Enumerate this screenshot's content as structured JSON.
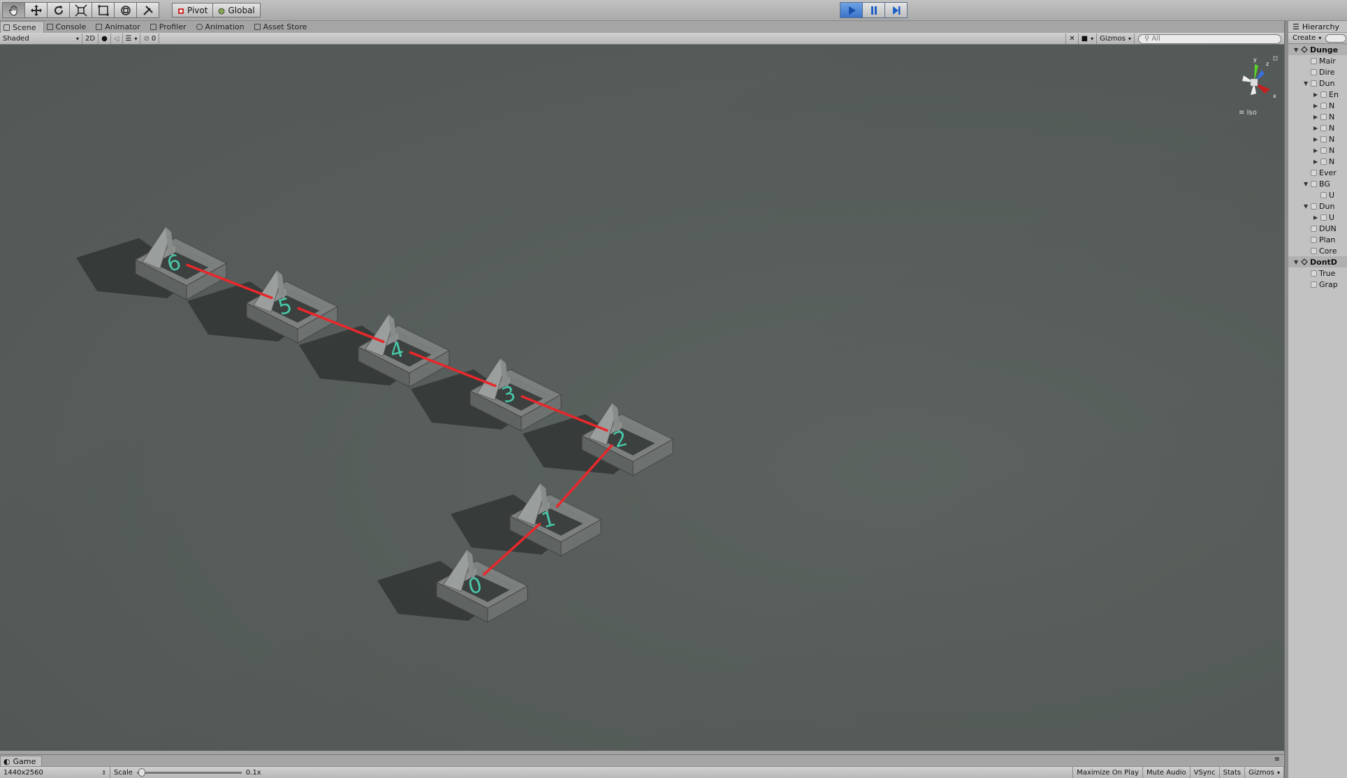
{
  "toolbar": {
    "tools": [
      "hand-icon",
      "move-icon",
      "rotate-icon",
      "scale-icon",
      "rect-icon",
      "transform-icon",
      "custom-tool-icon"
    ],
    "pivot_label": "Pivot",
    "global_label": "Global",
    "play_buttons": [
      "play-icon",
      "pause-icon",
      "step-icon"
    ]
  },
  "tabs": [
    {
      "label": "Scene",
      "icon": "scene-icon"
    },
    {
      "label": "Console",
      "icon": "console-icon"
    },
    {
      "label": "Animator",
      "icon": "animator-icon"
    },
    {
      "label": "Profiler",
      "icon": "profiler-icon"
    },
    {
      "label": "Animation",
      "icon": "animation-icon"
    },
    {
      "label": "Asset Store",
      "icon": "asset-store-icon"
    }
  ],
  "scene_toolbar": {
    "draw_mode": "Shaded",
    "mode_2d": "2D",
    "hidden_count": "0",
    "gizmos_label": "Gizmos",
    "search_placeholder": "All"
  },
  "scene": {
    "projection_label": "Iso",
    "axis_labels": {
      "x": "x",
      "y": "y",
      "z": "z"
    },
    "path_color": "#e8282b",
    "room_labels": [
      "0",
      "1",
      "2",
      "3",
      "4",
      "5",
      "6"
    ],
    "label_color": "#48c6a8"
  },
  "game": {
    "tab_label": "Game",
    "resolution": "1440x2560",
    "scale_label": "Scale",
    "scale_value": "0.1x",
    "toggles": [
      "Maximize On Play",
      "Mute Audio",
      "VSync",
      "Stats",
      "Gizmos"
    ]
  },
  "hierarchy": {
    "tab_label": "Hierarchy",
    "create_label": "Create",
    "rows": [
      {
        "label": "Dunge",
        "indent": 0,
        "arrow": "▼",
        "kind": "scene"
      },
      {
        "label": "Mair",
        "indent": 1,
        "arrow": "",
        "kind": "object"
      },
      {
        "label": "Dire",
        "indent": 1,
        "arrow": "",
        "kind": "object"
      },
      {
        "label": "Dun",
        "indent": 1,
        "arrow": "▼",
        "kind": "object"
      },
      {
        "label": "En",
        "indent": 2,
        "arrow": "▶",
        "kind": "object"
      },
      {
        "label": "N",
        "indent": 2,
        "arrow": "▶",
        "kind": "object"
      },
      {
        "label": "N",
        "indent": 2,
        "arrow": "▶",
        "kind": "object"
      },
      {
        "label": "N",
        "indent": 2,
        "arrow": "▶",
        "kind": "object"
      },
      {
        "label": "N",
        "indent": 2,
        "arrow": "▶",
        "kind": "object"
      },
      {
        "label": "N",
        "indent": 2,
        "arrow": "▶",
        "kind": "object"
      },
      {
        "label": "N",
        "indent": 2,
        "arrow": "▶",
        "kind": "object"
      },
      {
        "label": "Ever",
        "indent": 1,
        "arrow": "",
        "kind": "object"
      },
      {
        "label": "BG",
        "indent": 1,
        "arrow": "▼",
        "kind": "object"
      },
      {
        "label": "U",
        "indent": 2,
        "arrow": "",
        "kind": "object"
      },
      {
        "label": "Dun",
        "indent": 1,
        "arrow": "▼",
        "kind": "object"
      },
      {
        "label": "U",
        "indent": 2,
        "arrow": "▶",
        "kind": "object"
      },
      {
        "label": "DUN",
        "indent": 1,
        "arrow": "",
        "kind": "object"
      },
      {
        "label": "Plan",
        "indent": 1,
        "arrow": "",
        "kind": "object"
      },
      {
        "label": "Core",
        "indent": 1,
        "arrow": "",
        "kind": "object"
      },
      {
        "label": "DontD",
        "indent": 0,
        "arrow": "▼",
        "kind": "scene"
      },
      {
        "label": "True",
        "indent": 1,
        "arrow": "",
        "kind": "object"
      },
      {
        "label": "Grap",
        "indent": 1,
        "arrow": "",
        "kind": "object"
      }
    ]
  }
}
